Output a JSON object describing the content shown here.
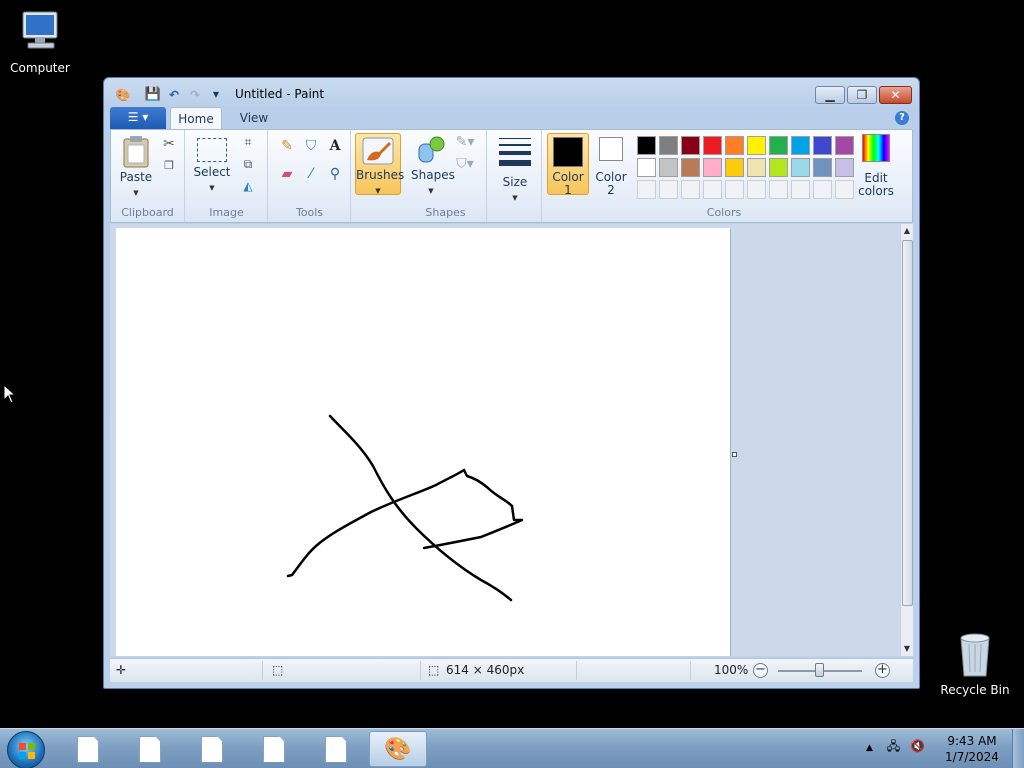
{
  "desktop": {
    "computer_label": "Computer",
    "recycle_label": "Recycle Bin"
  },
  "window": {
    "title": "Untitled - Paint",
    "tabs": {
      "home": "Home",
      "view": "View"
    }
  },
  "ribbon": {
    "clipboard": {
      "label": "Clipboard",
      "paste": "Paste"
    },
    "image": {
      "label": "Image",
      "select": "Select"
    },
    "tools": {
      "label": "Tools"
    },
    "brushes": "Brushes",
    "shapes": {
      "label": "Shapes",
      "button": "Shapes"
    },
    "size": "Size",
    "colors": {
      "label": "Colors",
      "color1": "Color",
      "color1_num": "1",
      "color2": "Color",
      "color2_num": "2",
      "edit1": "Edit",
      "edit2": "colors",
      "color1_value": "#000000",
      "color2_value": "#ffffff",
      "palette_row1": [
        "#000000",
        "#7f7f7f",
        "#880015",
        "#ed1c24",
        "#ff7f27",
        "#fff200",
        "#22b14c",
        "#00a2e8",
        "#3f48cc",
        "#a349a4"
      ],
      "palette_row2": [
        "#ffffff",
        "#c3c3c3",
        "#b97a57",
        "#ffaec9",
        "#ffc90e",
        "#efe4b0",
        "#b5e61d",
        "#99d9ea",
        "#7092be",
        "#c8bfe7"
      ]
    }
  },
  "status": {
    "canvas_size": "614 × 460px",
    "zoom": "100%"
  },
  "taskbar": {
    "time": "9:43 AM",
    "date": "1/7/2024"
  }
}
